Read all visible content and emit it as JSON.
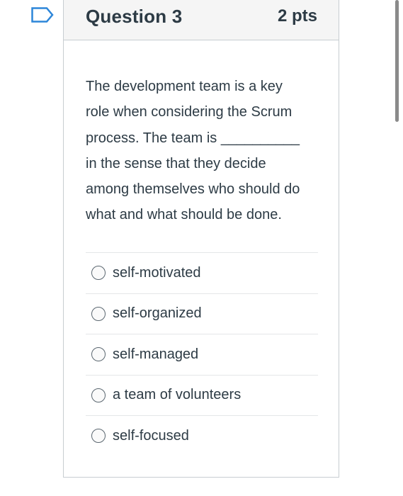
{
  "question": {
    "title": "Question 3",
    "points": "2 pts",
    "text_lines": [
      "The development team is a key",
      "role when considering the Scrum",
      "process. The team is __________",
      "in the sense that they decide",
      "among themselves who should do",
      "what and what should be done."
    ]
  },
  "answers": [
    {
      "label": "self-motivated",
      "selected": false
    },
    {
      "label": "self-organized",
      "selected": false
    },
    {
      "label": "self-managed",
      "selected": false
    },
    {
      "label": "a team of volunteers",
      "selected": false
    },
    {
      "label": "self-focused",
      "selected": false
    }
  ],
  "icons": {
    "flag": "flag-outline-icon",
    "radio": "radio-unselected-icon"
  },
  "colors": {
    "accent": "#2d86d9",
    "text": "#2d3b45",
    "header_bg": "#f5f5f5",
    "border": "#c7cdd1"
  }
}
